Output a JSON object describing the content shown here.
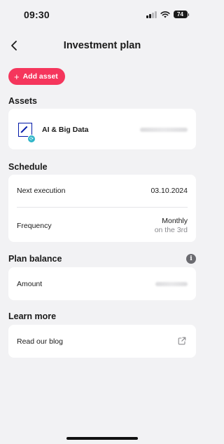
{
  "status_bar": {
    "time": "09:30",
    "battery": "74"
  },
  "header": {
    "title": "Investment plan",
    "back_icon": "chevron-left-icon"
  },
  "actions": {
    "add_asset_label": "Add asset"
  },
  "assets": {
    "section_title": "Assets",
    "items": [
      {
        "name": "AI & Big Data",
        "logo": "deutsche-bank-logo",
        "badge_icon": "sync-icon"
      }
    ]
  },
  "schedule": {
    "section_title": "Schedule",
    "next_execution_label": "Next execution",
    "next_execution_value": "03.10.2024",
    "frequency_label": "Frequency",
    "frequency_value": "Monthly",
    "frequency_detail": "on the 3rd"
  },
  "plan_balance": {
    "section_title": "Plan balance",
    "info_icon": "info-icon",
    "amount_label": "Amount"
  },
  "learn_more": {
    "section_title": "Learn more",
    "blog_label": "Read our blog",
    "external_icon": "external-link-icon"
  },
  "colors": {
    "accent": "#f5365c",
    "background": "#f2f2f4",
    "card": "#ffffff"
  }
}
